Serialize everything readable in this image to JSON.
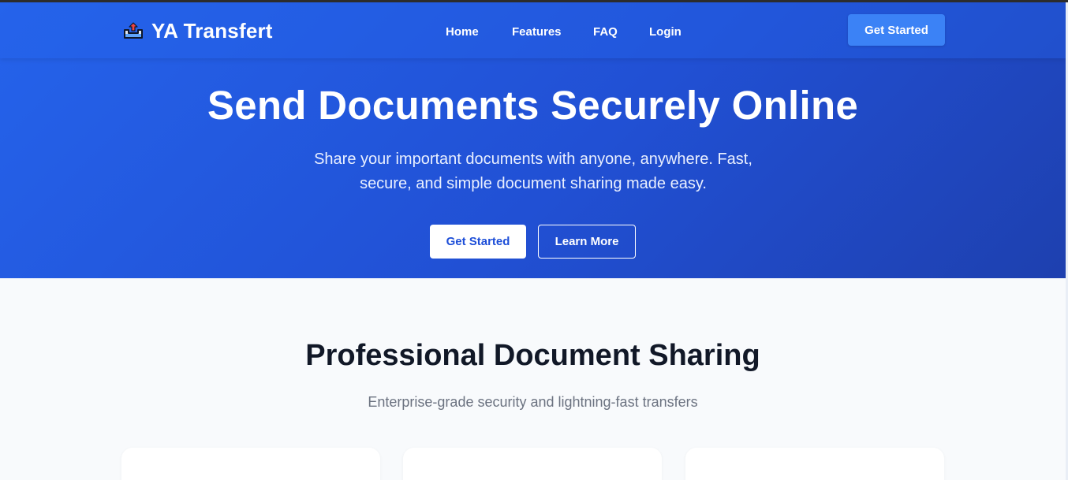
{
  "brand": {
    "name": "YA Transfert",
    "icon": "upload-tray-icon"
  },
  "nav": {
    "links": [
      "Home",
      "Features",
      "FAQ",
      "Login"
    ],
    "cta_label": "Get Started"
  },
  "hero": {
    "title": "Send Documents Securely Online",
    "subtitle": "Share your important documents with anyone, anywhere. Fast, secure, and simple document sharing made easy.",
    "primary_button": "Get Started",
    "secondary_button": "Learn More"
  },
  "features": {
    "title": "Professional Document Sharing",
    "subtitle": "Enterprise-grade security and lightning-fast transfers",
    "cards": [
      {},
      {},
      {}
    ]
  },
  "colors": {
    "hero_gradient_start": "#2563eb",
    "hero_gradient_end": "#1e40af",
    "nav_cta_bg": "#3b82f6",
    "page_bg": "#f8fafc",
    "heading_text": "#111827",
    "muted_text": "#6b7280"
  }
}
